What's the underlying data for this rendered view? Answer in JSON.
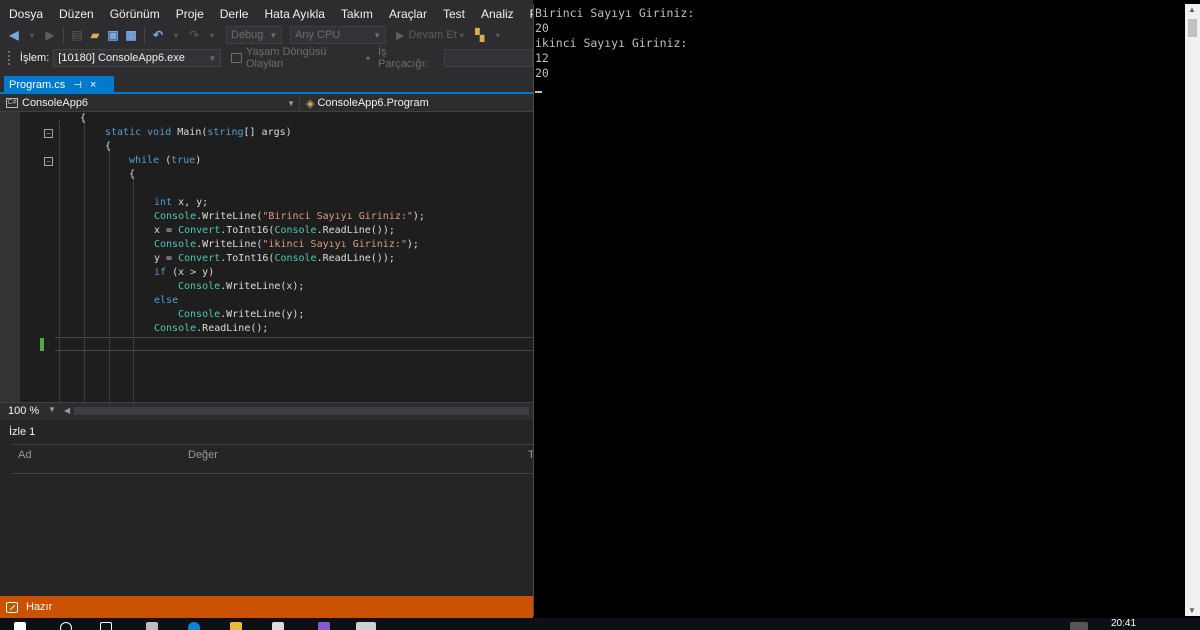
{
  "menu": [
    "Dosya",
    "Düzen",
    "Görünüm",
    "Proje",
    "Derle",
    "Hata Ayıkla",
    "Takım",
    "Araçlar",
    "Test",
    "Analiz",
    "Pencere"
  ],
  "toolbar": {
    "configuration": "Debug",
    "platform": "Any CPU",
    "continue_label": "Devam Et"
  },
  "debug_toolbar": {
    "process_label": "İşlem:",
    "process_value": "[10180] ConsoleApp6.exe",
    "lifecycle_label": "Yaşam Döngüsü Olaylan",
    "thread_label": "İş Parçacığı:"
  },
  "tab": {
    "title": "Program.cs",
    "pin": "⊣",
    "close": "×"
  },
  "navbar": {
    "project": "ConsoleApp6",
    "type": "ConsoleApp6.Program"
  },
  "code": {
    "open_brace_class": "{",
    "main_kw_static": "static",
    "main_kw_void": "void",
    "main_name": " Main(",
    "main_kw_string": "string",
    "main_rest": "[] args)",
    "open_brace_method": "{",
    "while_kw": "while",
    "while_open": " (",
    "while_true": "true",
    "while_close": ")",
    "open_brace_loop": "{",
    "int_kw": "int",
    "int_rest": " x, y;",
    "console": "Console",
    "convert": "Convert",
    "writeline": ".WriteLine(",
    "str1": "\"Birinci Sayıyı Giriniz:\"",
    "str2": "\"ikinci Sayıyı Giriniz:\"",
    "end_stmt": ");",
    "x_assign": "x = ",
    "y_assign": "y = ",
    "toint": ".ToInt16(",
    "readline_inner": ".ReadLine());",
    "if_kw": "if",
    "if_rest": " (x > y)",
    "else_kw": "else",
    "wl_x": ".WriteLine(x);",
    "wl_y": ".WriteLine(y);",
    "readline_stmt": ".ReadLine();"
  },
  "zoom": "100 %",
  "watch": {
    "title": "İzle 1",
    "col_name": "Ad",
    "col_value": "Değer",
    "col_type": "T"
  },
  "status": {
    "text": "Hazır"
  },
  "console_output": [
    "Birinci Sayıyı Giriniz:",
    "20",
    "ikinci Sayıyı Giriniz:",
    "12",
    "20"
  ],
  "taskbar": {
    "clock": "20:41"
  },
  "colors": {
    "accent": "#007acc",
    "status_bar": "#ca5100",
    "editor_bg": "#1e1e1e",
    "keyword": "#569cd6",
    "type": "#4ec9b0",
    "string": "#d69d85"
  }
}
